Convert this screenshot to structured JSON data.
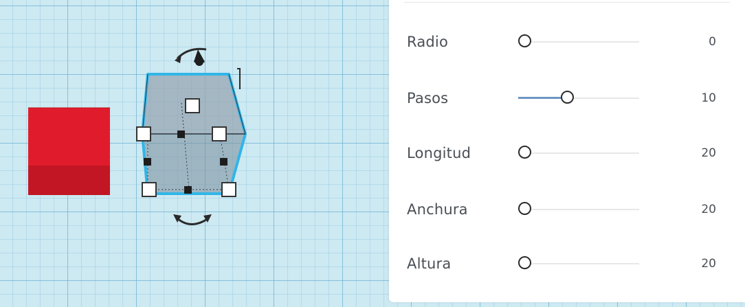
{
  "viewport": {
    "grid_color": "#5faacd",
    "objects": [
      {
        "name": "red-box",
        "color": "#d91e2e"
      },
      {
        "name": "selected-hole-box",
        "color": "#8ea0ac",
        "outline": "#2fb6e6"
      }
    ]
  },
  "properties": {
    "rows": [
      {
        "label": "Radio",
        "value": "0",
        "min": 0,
        "max": 25,
        "current": 0
      },
      {
        "label": "Pasos",
        "value": "10",
        "min": 0,
        "max": 25,
        "current": 10
      },
      {
        "label": "Longitud",
        "value": "20",
        "min": 20,
        "max": 200,
        "current": 20
      },
      {
        "label": "Anchura",
        "value": "20",
        "min": 20,
        "max": 200,
        "current": 20
      },
      {
        "label": "Altura",
        "value": "20",
        "min": 20,
        "max": 200,
        "current": 20
      }
    ],
    "accent": "#6b96c3"
  }
}
